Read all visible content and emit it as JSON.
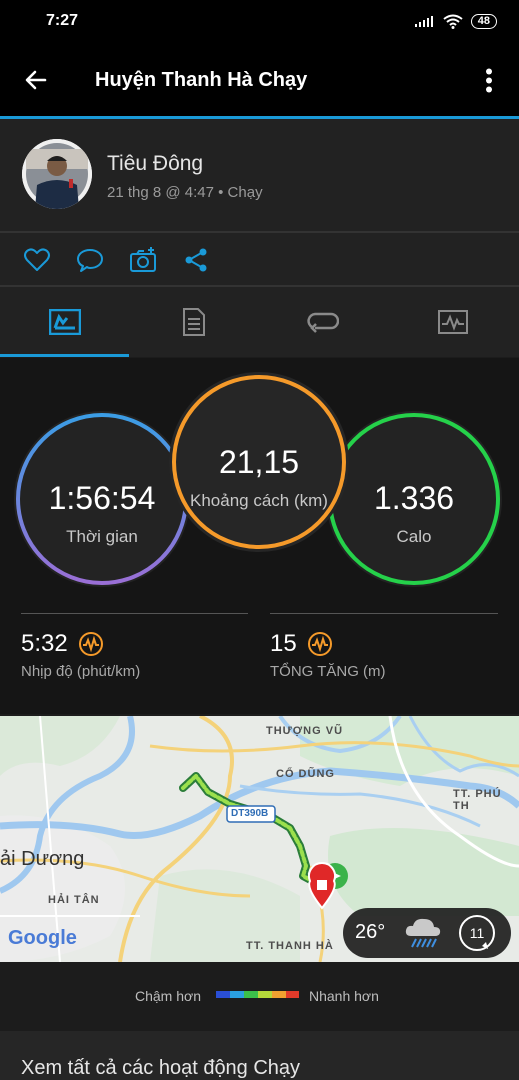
{
  "status": {
    "time": "7:27",
    "battery": "48"
  },
  "header": {
    "title": "Huyện Thanh Hà Chạy",
    "back_icon": "arrow-left-icon",
    "menu_icon": "more-vertical-icon"
  },
  "profile": {
    "name": "Tiêu Đông",
    "meta": "21 thg 8 @ 4:47 • Chạy"
  },
  "actions": [
    "heart-icon",
    "comment-icon",
    "camera-add-icon",
    "share-icon"
  ],
  "tabs": [
    "summary-icon",
    "details-icon",
    "laps-icon",
    "charts-icon"
  ],
  "colors": {
    "accent": "#1a9ad8",
    "time_ring": "#6b7ee0",
    "distance_ring": "#f59a2a",
    "calories_ring": "#25d14a",
    "pace_icon": "#f59a2a"
  },
  "rings": {
    "time": {
      "value": "1:56:54",
      "label": "Thời gian"
    },
    "distance": {
      "value": "21,15",
      "label": "Khoảng cách (km)"
    },
    "calories": {
      "value": "1.336",
      "label": "Calo"
    }
  },
  "stats": {
    "pace": {
      "value": "5:32",
      "label": "Nhịp độ (phút/km)"
    },
    "ascent": {
      "value": "15",
      "label": "TỔNG TĂNG (m)"
    }
  },
  "map": {
    "labels": {
      "thuong_vu": "THƯỢNG VŨ",
      "co_dung": "CỔ DŨNG",
      "tt_phu_thai": "TT. PHÚ TH",
      "road": "DT390B",
      "hai_duong": "ải Dương",
      "hai_tan": "HẢI TÂN",
      "tt_thanh_ha": "TT. THANH HÀ"
    },
    "google": "Google",
    "weather": {
      "temp": "26°",
      "wind": "11"
    }
  },
  "legend": {
    "slower": "Chậm hơn",
    "faster": "Nhanh hơn"
  },
  "footer": {
    "link": "Xem tất cả các hoạt động Chạy"
  }
}
